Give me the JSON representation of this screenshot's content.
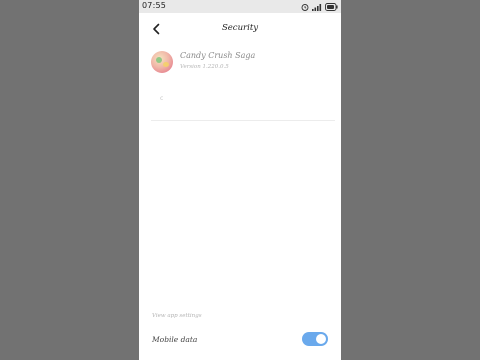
{
  "status_bar": {
    "time": "07:55",
    "icons": [
      "alarm-icon",
      "signal-icon",
      "battery-icon"
    ]
  },
  "header": {
    "title": "Security",
    "back_icon": "chevron-left-icon"
  },
  "app": {
    "name": "Candy Crush Saga",
    "version": "Version 1.220.0.5",
    "icon": "candy-crush-app-icon"
  },
  "small_mark": "c",
  "section": {
    "label": "View app settings"
  },
  "mobile_data": {
    "label": "Mobile data",
    "enabled": true
  },
  "colors": {
    "toggle_on": "#6aa9ec",
    "backdrop": "#727272"
  }
}
